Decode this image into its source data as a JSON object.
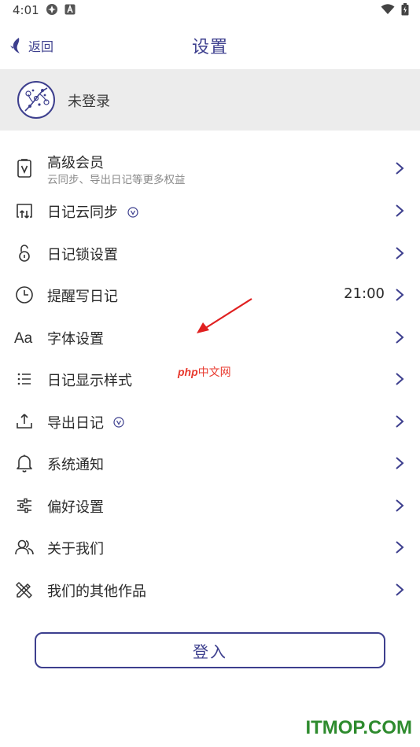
{
  "status_bar": {
    "time": "4:01"
  },
  "nav": {
    "back_label": "返回",
    "title": "设置"
  },
  "account": {
    "status": "未登录"
  },
  "menu": {
    "items": [
      {
        "label": "高级会员",
        "sublabel": "云同步、导出日记等更多权益",
        "icon": "vip-card-icon"
      },
      {
        "label": "日记云同步",
        "icon": "cloud-sync-icon",
        "badge": "vip-badge-icon"
      },
      {
        "label": "日记锁设置",
        "icon": "lock-icon"
      },
      {
        "label": "提醒写日记",
        "icon": "clock-icon",
        "value": "21:00"
      },
      {
        "label": "字体设置",
        "icon": "font-icon"
      },
      {
        "label": "日记显示样式",
        "icon": "list-style-icon"
      },
      {
        "label": "导出日记",
        "icon": "export-icon",
        "badge": "vip-badge-icon"
      },
      {
        "label": "系统通知",
        "icon": "bell-icon"
      },
      {
        "label": "偏好设置",
        "icon": "sliders-icon"
      },
      {
        "label": "关于我们",
        "icon": "people-icon"
      },
      {
        "label": "我们的其他作品",
        "icon": "design-tools-icon"
      }
    ]
  },
  "login_button": {
    "label": "登入"
  },
  "watermarks": {
    "php_prefix": "php",
    "php_suffix": "中文网",
    "site": "ITMOP.COM"
  },
  "colors": {
    "accent": "#3d3f8e",
    "account_bg": "#ececec",
    "annotation_arrow": "#e02020",
    "site_watermark": "#2e8b2e"
  }
}
